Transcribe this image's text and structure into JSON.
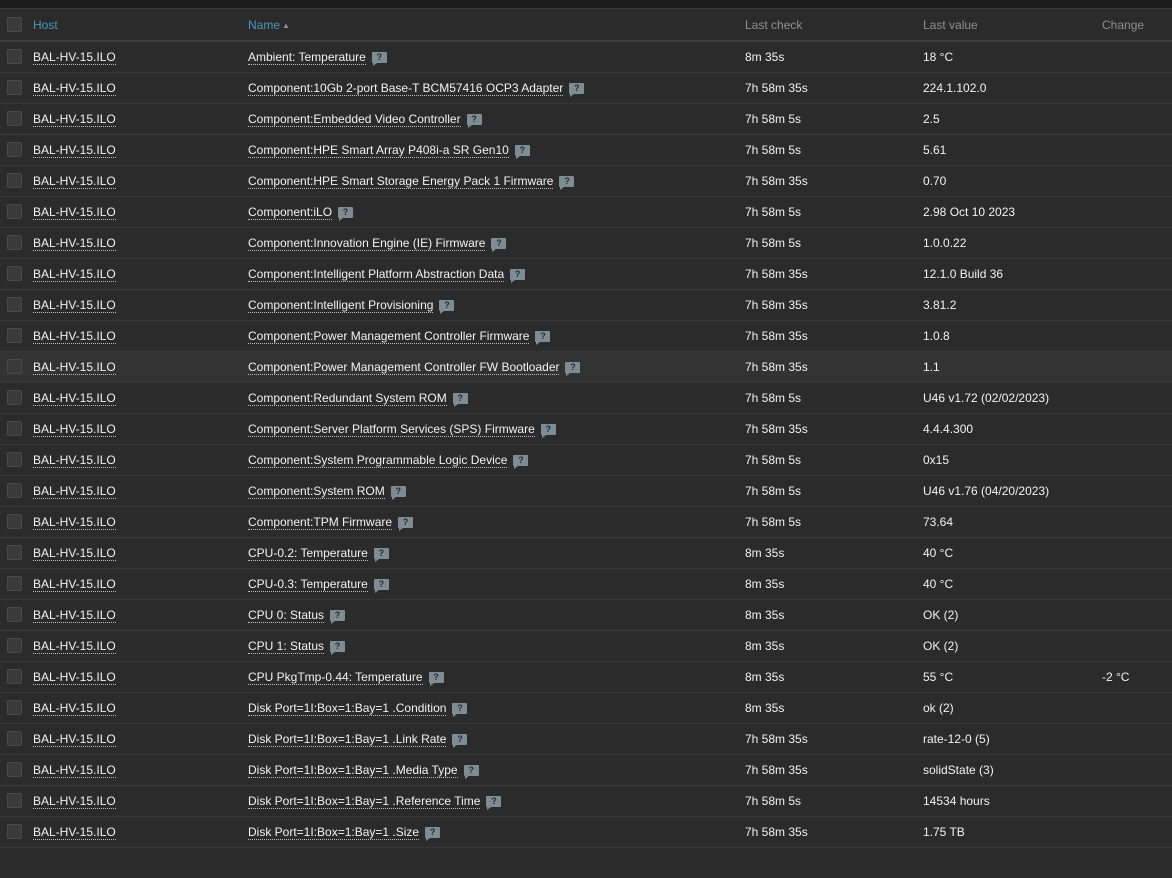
{
  "columns": {
    "host": "Host",
    "name": "Name",
    "last_check": "Last check",
    "last_value": "Last value",
    "change": "Change"
  },
  "sort": {
    "column": "Name",
    "direction": "ascending",
    "icon": "sort-up-icon"
  },
  "help_icon_glyph": "?",
  "rows": [
    {
      "host": "BAL-HV-15.ILO",
      "name": "Ambient: Temperature",
      "last_check": "8m 35s",
      "last_value": "18 °C",
      "change": ""
    },
    {
      "host": "BAL-HV-15.ILO",
      "name": "Component:10Gb 2-port Base-T BCM57416 OCP3 Adapter",
      "last_check": "7h 58m 35s",
      "last_value": "224.1.102.0",
      "change": ""
    },
    {
      "host": "BAL-HV-15.ILO",
      "name": "Component:Embedded Video Controller",
      "last_check": "7h 58m 5s",
      "last_value": "2.5",
      "change": ""
    },
    {
      "host": "BAL-HV-15.ILO",
      "name": "Component:HPE Smart Array P408i-a SR Gen10",
      "last_check": "7h 58m 5s",
      "last_value": "5.61",
      "change": ""
    },
    {
      "host": "BAL-HV-15.ILO",
      "name": "Component:HPE Smart Storage Energy Pack 1 Firmware",
      "last_check": "7h 58m 35s",
      "last_value": "0.70",
      "change": ""
    },
    {
      "host": "BAL-HV-15.ILO",
      "name": "Component:iLO",
      "last_check": "7h 58m 5s",
      "last_value": "2.98 Oct 10 2023",
      "change": ""
    },
    {
      "host": "BAL-HV-15.ILO",
      "name": "Component:Innovation Engine (IE) Firmware",
      "last_check": "7h 58m 5s",
      "last_value": "1.0.0.22",
      "change": ""
    },
    {
      "host": "BAL-HV-15.ILO",
      "name": "Component:Intelligent Platform Abstraction Data",
      "last_check": "7h 58m 35s",
      "last_value": "12.1.0 Build 36",
      "change": ""
    },
    {
      "host": "BAL-HV-15.ILO",
      "name": "Component:Intelligent Provisioning",
      "last_check": "7h 58m 35s",
      "last_value": "3.81.2",
      "change": ""
    },
    {
      "host": "BAL-HV-15.ILO",
      "name": "Component:Power Management Controller Firmware",
      "last_check": "7h 58m 35s",
      "last_value": "1.0.8",
      "change": ""
    },
    {
      "host": "BAL-HV-15.ILO",
      "name": "Component:Power Management Controller FW Bootloader",
      "last_check": "7h 58m 35s",
      "last_value": "1.1",
      "change": ""
    },
    {
      "host": "BAL-HV-15.ILO",
      "name": "Component:Redundant System ROM",
      "last_check": "7h 58m 5s",
      "last_value": "U46 v1.72 (02/02/2023)",
      "change": ""
    },
    {
      "host": "BAL-HV-15.ILO",
      "name": "Component:Server Platform Services (SPS) Firmware",
      "last_check": "7h 58m 35s",
      "last_value": "4.4.4.300",
      "change": ""
    },
    {
      "host": "BAL-HV-15.ILO",
      "name": "Component:System Programmable Logic Device",
      "last_check": "7h 58m 5s",
      "last_value": "0x15",
      "change": ""
    },
    {
      "host": "BAL-HV-15.ILO",
      "name": "Component:System ROM",
      "last_check": "7h 58m 5s",
      "last_value": "U46 v1.76 (04/20/2023)",
      "change": ""
    },
    {
      "host": "BAL-HV-15.ILO",
      "name": "Component:TPM Firmware",
      "last_check": "7h 58m 5s",
      "last_value": "73.64",
      "change": ""
    },
    {
      "host": "BAL-HV-15.ILO",
      "name": "CPU-0.2: Temperature",
      "last_check": "8m 35s",
      "last_value": "40 °C",
      "change": ""
    },
    {
      "host": "BAL-HV-15.ILO",
      "name": "CPU-0.3: Temperature",
      "last_check": "8m 35s",
      "last_value": "40 °C",
      "change": ""
    },
    {
      "host": "BAL-HV-15.ILO",
      "name": "CPU 0: Status",
      "last_check": "8m 35s",
      "last_value": "OK (2)",
      "change": ""
    },
    {
      "host": "BAL-HV-15.ILO",
      "name": "CPU 1: Status",
      "last_check": "8m 35s",
      "last_value": "OK (2)",
      "change": ""
    },
    {
      "host": "BAL-HV-15.ILO",
      "name": "CPU PkgTmp-0.44: Temperature",
      "last_check": "8m 35s",
      "last_value": "55 °C",
      "change": "-2 °C"
    },
    {
      "host": "BAL-HV-15.ILO",
      "name": "Disk Port=1I:Box=1:Bay=1 .Condition",
      "last_check": "8m 35s",
      "last_value": "ok (2)",
      "change": ""
    },
    {
      "host": "BAL-HV-15.ILO",
      "name": "Disk Port=1I:Box=1:Bay=1 .Link Rate",
      "last_check": "7h 58m 35s",
      "last_value": "rate-12-0 (5)",
      "change": ""
    },
    {
      "host": "BAL-HV-15.ILO",
      "name": "Disk Port=1I:Box=1:Bay=1 .Media Type",
      "last_check": "7h 58m 35s",
      "last_value": "solidState (3)",
      "change": ""
    },
    {
      "host": "BAL-HV-15.ILO",
      "name": "Disk Port=1I:Box=1:Bay=1 .Reference Time",
      "last_check": "7h 58m 5s",
      "last_value": "14534 hours",
      "change": ""
    },
    {
      "host": "BAL-HV-15.ILO",
      "name": "Disk Port=1I:Box=1:Bay=1 .Size",
      "last_check": "7h 58m 35s",
      "last_value": "1.75 TB",
      "change": ""
    }
  ],
  "highlighted_row_index": 10
}
